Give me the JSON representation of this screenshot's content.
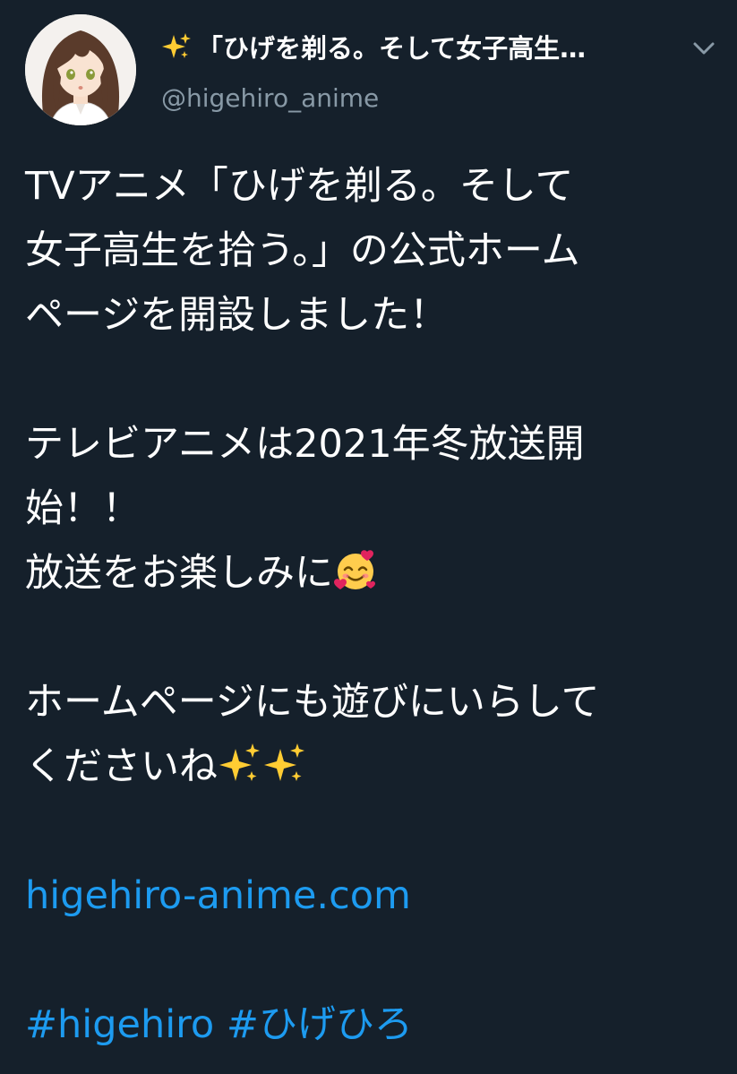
{
  "tweet": {
    "author": {
      "display_name": "「ひげを剃る。そして女子高生…",
      "display_name_prefix_icon": "sparkles-icon",
      "handle": "@higehiro_anime",
      "avatar_icon": "anime-girl-avatar"
    },
    "menu_icon": "chevron-down-icon",
    "body": {
      "line1": "TVアニメ「ひげを剃る。そして",
      "line2": "女子高生を拾う。」の公式ホーム",
      "line3": "ページを開設しました！",
      "line4": "テレビアニメは2021年冬放送開",
      "line5": "始！！",
      "line6": "放送をお楽しみに",
      "line6_emoji": "smiling-face-with-hearts-emoji",
      "line7": "ホームページにも遊びにいらして",
      "line8": "くださいね",
      "line8_emoji": "sparkles-emoji",
      "link": "higehiro-anime.com",
      "hashtag1": "#higehiro",
      "hashtag2": "#ひげひろ"
    }
  },
  "colors": {
    "background": "#15202b",
    "text": "#ffffff",
    "secondary_text": "#8899a6",
    "link": "#1d9bf0"
  }
}
